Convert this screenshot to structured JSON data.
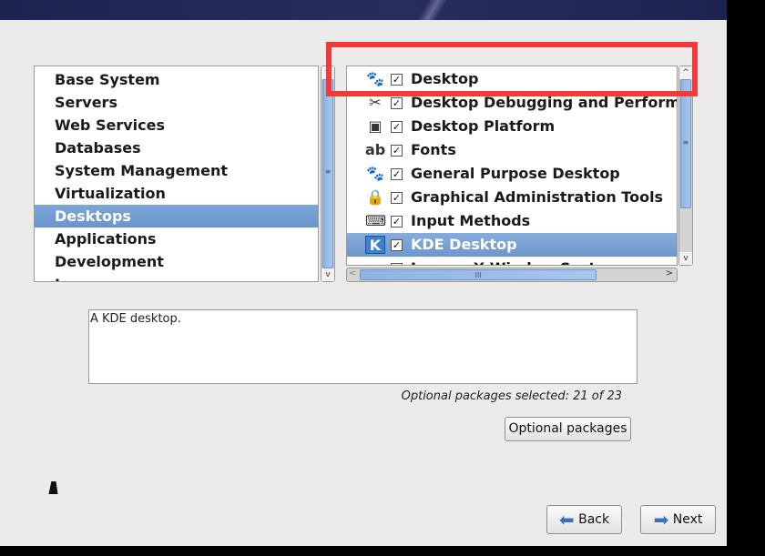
{
  "categories": [
    "Base System",
    "Servers",
    "Web Services",
    "Databases",
    "System Management",
    "Virtualization",
    "Desktops",
    "Applications",
    "Development",
    "Languages"
  ],
  "selected_category": "Desktops",
  "packages": [
    {
      "label": "Desktop",
      "icon": "gnome-foot-icon",
      "checked": true
    },
    {
      "label": "Desktop Debugging and Performance Tools",
      "icon": "tools-icon",
      "checked": true
    },
    {
      "label": "Desktop Platform",
      "icon": "desktop-platform-icon",
      "checked": true
    },
    {
      "label": "Fonts",
      "icon": "fonts-icon",
      "checked": true
    },
    {
      "label": "General Purpose Desktop",
      "icon": "gnome-foot-icon",
      "checked": true
    },
    {
      "label": "Graphical Administration Tools",
      "icon": "admin-lock-icon",
      "checked": true
    },
    {
      "label": "Input Methods",
      "icon": "keyboard-icon",
      "checked": true
    },
    {
      "label": "KDE Desktop",
      "icon": "kde-icon",
      "checked": true,
      "selected": true
    },
    {
      "label": "Legacy X Window System compatibility",
      "icon": "monitor-icon",
      "checked": true
    }
  ],
  "description": "A KDE desktop.",
  "optional_status": "Optional packages selected: 21 of 23",
  "buttons": {
    "optional": "Optional packages",
    "back": "Back",
    "next": "Next"
  },
  "highlight_color": "#f23a3a"
}
